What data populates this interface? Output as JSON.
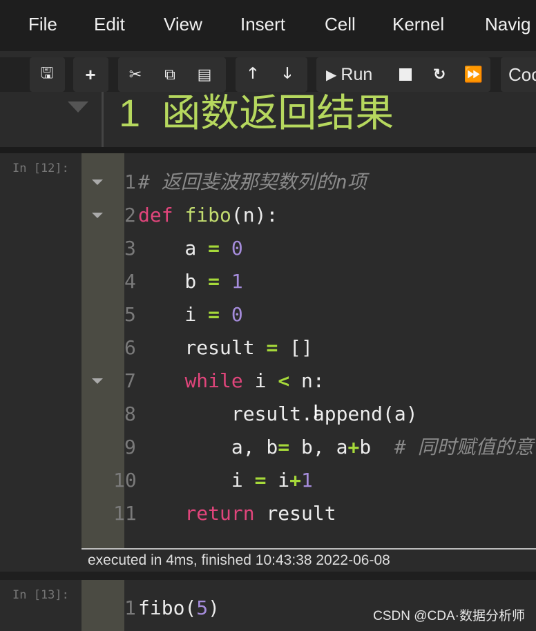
{
  "menu": [
    "File",
    "Edit",
    "View",
    "Insert",
    "Cell",
    "Kernel",
    "Navig"
  ],
  "toolbar": {
    "buttons": [
      "save-icon",
      "plus-icon",
      "cut-icon",
      "copy-icon",
      "paste-icon",
      "arrow-up-icon",
      "arrow-down-icon",
      "play-icon",
      "stop-icon",
      "restart-icon",
      "fast-forward-icon"
    ],
    "run_label": "Run",
    "cell_type": "Coc"
  },
  "markdown_cell": {
    "heading": "1  函数返回结果"
  },
  "cell1": {
    "prompt": "In [12]:",
    "lines": [
      [
        [
          "# 返回斐波那契数列的n项",
          "com"
        ]
      ],
      [
        [
          "def",
          "kw"
        ],
        [
          " ",
          "def"
        ],
        [
          "fibo",
          "fn"
        ],
        [
          "(n):",
          "def"
        ]
      ],
      [
        [
          "    a ",
          "def"
        ],
        [
          "=",
          "op"
        ],
        [
          " ",
          "def"
        ],
        [
          "0",
          "num"
        ]
      ],
      [
        [
          "    b ",
          "def"
        ],
        [
          "=",
          "op"
        ],
        [
          " ",
          "def"
        ],
        [
          "1",
          "num"
        ]
      ],
      [
        [
          "    i ",
          "def"
        ],
        [
          "=",
          "op"
        ],
        [
          " ",
          "def"
        ],
        [
          "0",
          "num"
        ]
      ],
      [
        [
          "    result ",
          "def"
        ],
        [
          "=",
          "op"
        ],
        [
          " []",
          "def"
        ]
      ],
      [
        [
          "    ",
          "def"
        ],
        [
          "while",
          "kw"
        ],
        [
          " i ",
          "def"
        ],
        [
          "<",
          "op"
        ],
        [
          " n:",
          "def"
        ]
      ],
      [
        [
          "        result.append(a)",
          "def"
        ]
      ],
      [
        [
          "        a, b",
          "def"
        ],
        [
          "=",
          "op"
        ],
        [
          " b, a",
          "def"
        ],
        [
          "+",
          "op"
        ],
        [
          "b  ",
          "def"
        ],
        [
          "# 同时赋值的意",
          "com"
        ]
      ],
      [
        [
          "        i ",
          "def"
        ],
        [
          "=",
          "op"
        ],
        [
          " i",
          "def"
        ],
        [
          "+",
          "op"
        ],
        [
          "1",
          "num"
        ]
      ],
      [
        [
          "    ",
          "def"
        ],
        [
          "return",
          "kw"
        ],
        [
          " result",
          "def"
        ]
      ]
    ],
    "folds": [
      1,
      2,
      7
    ],
    "output": "executed in 4ms, finished 10:43:38 2022-06-08"
  },
  "cell2": {
    "prompt": "In [13]:",
    "lines": [
      [
        [
          "fibo(",
          "def"
        ],
        [
          "5",
          "num"
        ],
        [
          ")",
          "def"
        ]
      ]
    ]
  },
  "watermark": "CSDN @CDA·数据分析师",
  "colors": {
    "keyword": "#e0457b",
    "function": "#c2dc6f",
    "number": "#a58cdb",
    "operator": "#a6d93a",
    "comment": "#8a8a8a",
    "heading": "#b6d85e"
  }
}
